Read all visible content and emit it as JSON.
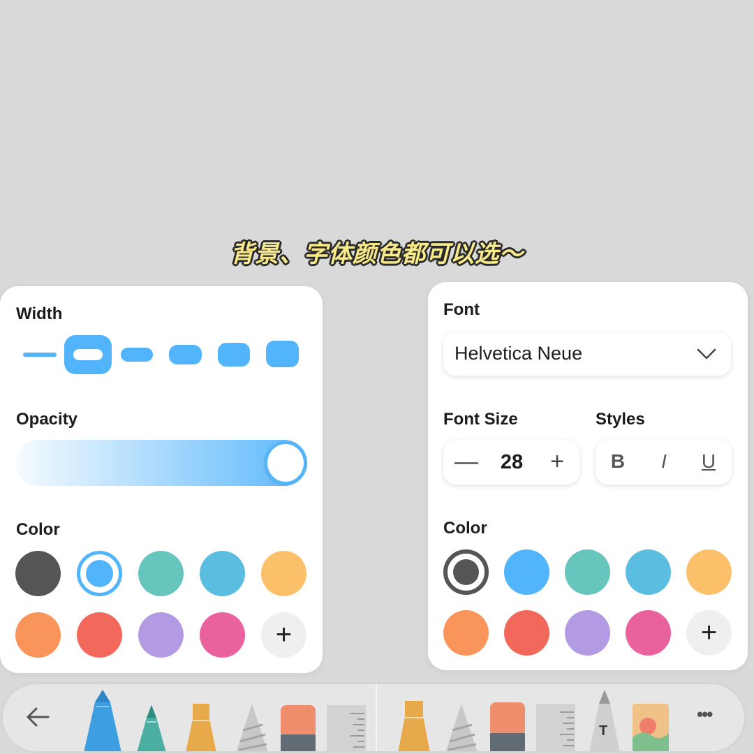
{
  "caption": "背景、字体颜色都可以选～",
  "left_panel": {
    "width_label": "Width",
    "opacity_label": "Opacity",
    "opacity_value": 1.0,
    "color_label": "Color",
    "selected_width_index": 1,
    "colors": [
      "#555555",
      "#52b4fb",
      "#66c6bd",
      "#5bbde0",
      "#fdc06a",
      "#f9955a",
      "#f2695c",
      "#b39be3",
      "#ea629d"
    ],
    "selected_color_index": 1,
    "add_color_label": "+"
  },
  "right_panel": {
    "font_label": "Font",
    "font_value": "Helvetica Neue",
    "font_size_label": "Font Size",
    "font_size_value": "28",
    "minus_label": "—",
    "plus_label": "+",
    "styles_label": "Styles",
    "bold_label": "B",
    "italic_label": "I",
    "underline_label": "U",
    "color_label": "Color",
    "colors": [
      "#555555",
      "#52b4fb",
      "#66c6bd",
      "#5bbde0",
      "#fdc06a",
      "#f9955a",
      "#f2695c",
      "#b39be3",
      "#ea629d"
    ],
    "selected_color_index": 0,
    "add_color_label": "+"
  },
  "toolbar": {
    "back_icon": "arrow-left-icon",
    "more_label": "•••",
    "text_tool_label": "T",
    "tools": [
      "pen",
      "marker",
      "highlighter",
      "pencil",
      "eraser",
      "ruler",
      "highlighter",
      "pencil",
      "eraser",
      "ruler",
      "text-pen",
      "image"
    ]
  }
}
